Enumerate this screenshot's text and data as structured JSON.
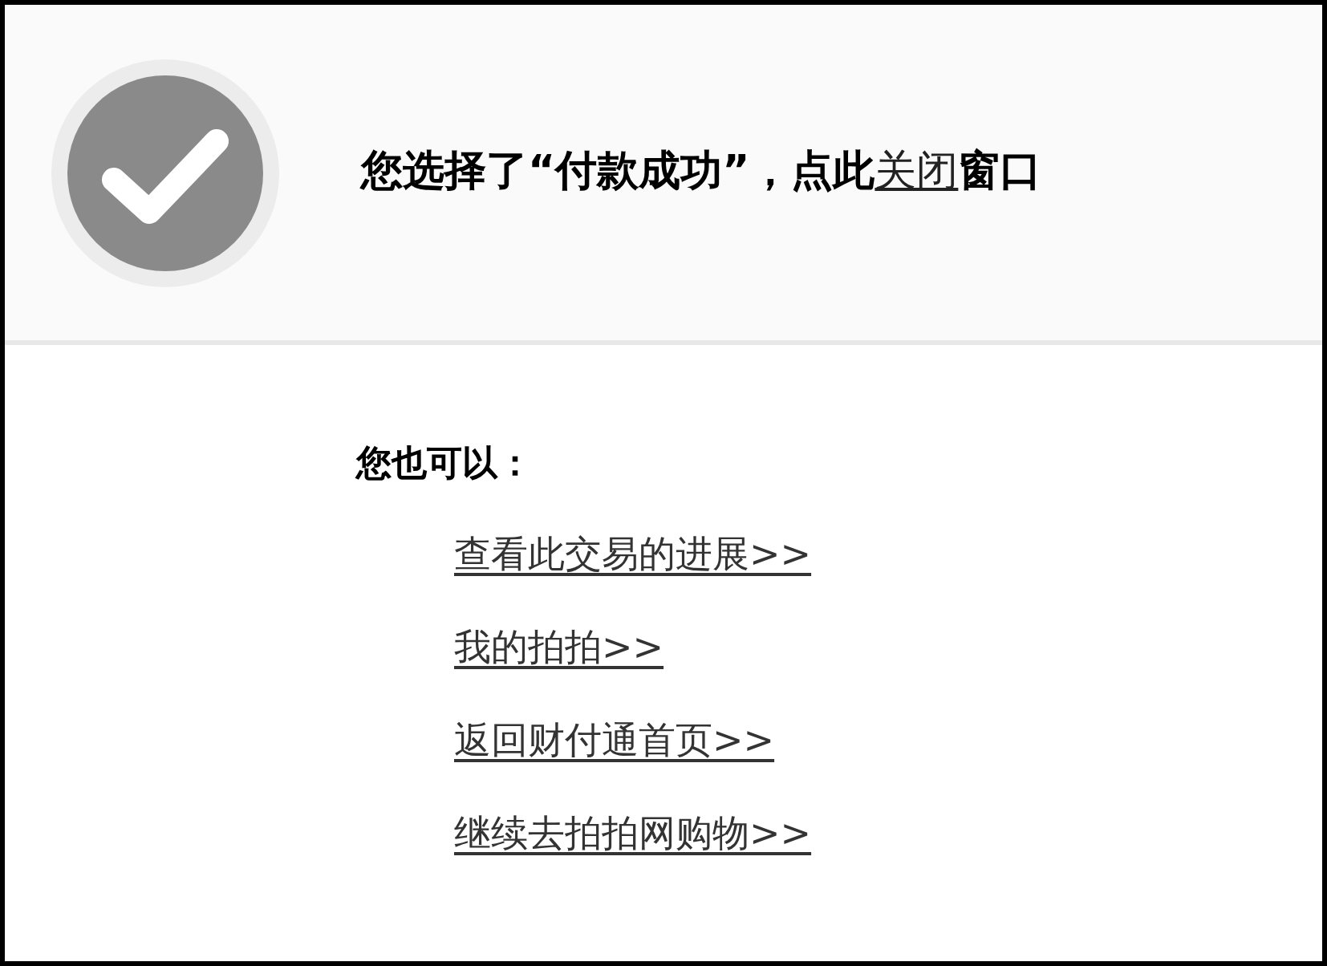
{
  "message": {
    "before": "您选择了“付款成功”，点此",
    "link": "关闭",
    "after": "窗口"
  },
  "options_heading": "您也可以：",
  "links": [
    "查看此交易的进展>>",
    "我的拍拍>>",
    "返回财付通首页>>",
    "继续去拍拍网购物>>"
  ]
}
